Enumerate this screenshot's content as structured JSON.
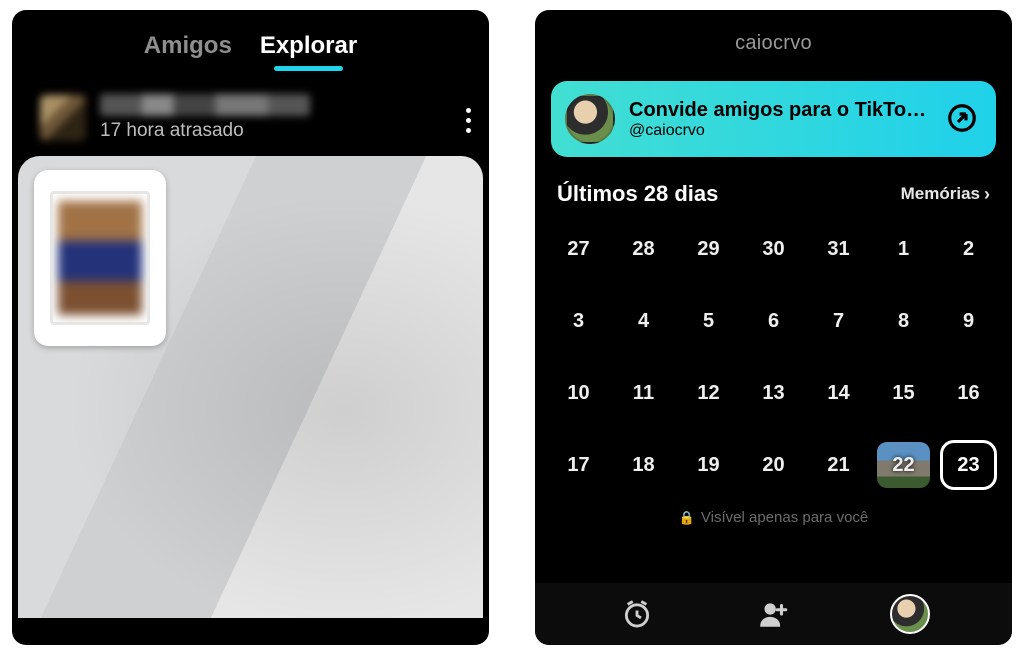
{
  "left": {
    "tabs": {
      "friends": "Amigos",
      "explore": "Explorar",
      "active": "explore"
    },
    "post": {
      "time": "17 hora atrasado"
    }
  },
  "right": {
    "title": "caiocrvo",
    "invite": {
      "title": "Convide amigos para o TikTok N...",
      "handle": "@caiocrvo"
    },
    "section": {
      "title": "Últimos 28 dias",
      "memories": "Memórias"
    },
    "calendar": {
      "days": [
        27,
        28,
        29,
        30,
        31,
        1,
        2,
        3,
        4,
        5,
        6,
        7,
        8,
        9,
        10,
        11,
        12,
        13,
        14,
        15,
        16,
        17,
        18,
        19,
        20,
        21,
        22,
        23
      ],
      "thumb_on": 22,
      "today": 23
    },
    "privacy": "Visível apenas para você",
    "nav": {
      "items": [
        "clock",
        "add-friend",
        "profile"
      ],
      "active": "profile"
    }
  }
}
